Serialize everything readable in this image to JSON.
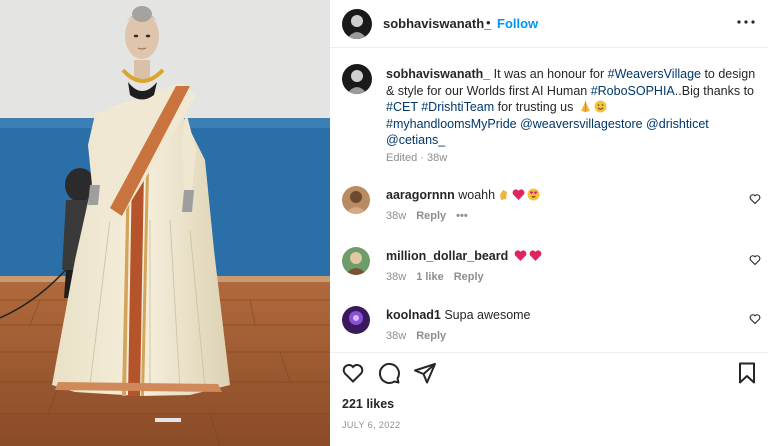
{
  "post": {
    "username": "sobhaviswanath_",
    "follow_label": "Follow",
    "separator": "•",
    "more_icon": "more-horizontal-icon"
  },
  "caption": {
    "username": "sobhaviswanath_",
    "t1": " It was an honour for ",
    "tag1": "#WeaversVillage",
    "t2": " to design & style for our Worlds first AI Human ",
    "tag2": "#RoboSOPHIA",
    "t3": "..Big thanks to ",
    "tag3": "#CET",
    "t4": " ",
    "tag4": "#DrishtiTeam",
    "t5": " for trusting us ",
    "emoji": [
      "folded-hands-emoji",
      "smiling-face-emoji"
    ],
    "tag5": "#myhandloomsMyPride",
    "t6": " ",
    "tag6": "@weaversvillagestore",
    "t7": " ",
    "tag7": "@drishticet",
    "tag8": "@cetians_",
    "edited": "Edited · 38w"
  },
  "comments": [
    {
      "username": "aaragornnn",
      "text": " woahh",
      "emoji": [
        "clapping-hands-emoji",
        "red-heart-emoji",
        "heart-eyes-emoji"
      ],
      "time": "38w",
      "likes": "",
      "reply": "Reply",
      "more": "•••"
    },
    {
      "username": "million_dollar_beard",
      "text": " ",
      "emoji": [
        "red-heart-emoji",
        "red-heart-emoji"
      ],
      "time": "38w",
      "likes": "1 like",
      "reply": "Reply"
    },
    {
      "username": "koolnad1",
      "text": " Supa awesome",
      "emoji": [],
      "time": "38w",
      "likes": "",
      "reply": "Reply"
    }
  ],
  "actions": {
    "icons": [
      "heart-icon",
      "comment-icon",
      "share-icon",
      "bookmark-icon"
    ],
    "likes": "221 likes",
    "date": "JULY 6, 2022"
  },
  "colors": {
    "link": "#0095f6",
    "tag": "#00376b",
    "secondary": "#8e8e8e",
    "heart": "#ed4956"
  }
}
